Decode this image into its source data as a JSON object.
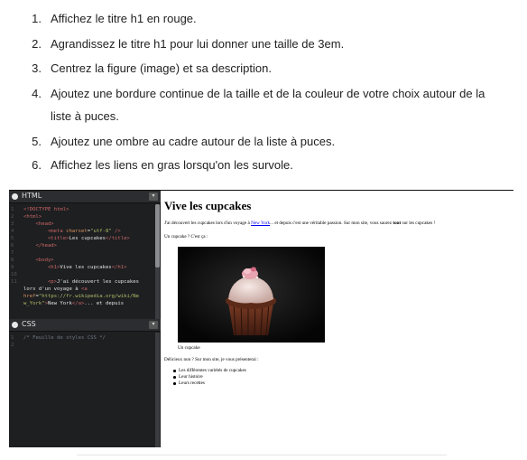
{
  "instructions": [
    {
      "num": "1.",
      "text": "Affichez le titre h1 en rouge."
    },
    {
      "num": "2.",
      "text": "Agrandissez le titre h1 pour lui donner une taille de 3em."
    },
    {
      "num": "3.",
      "text": "Centrez la figure (image) et sa description."
    },
    {
      "num": "4.",
      "text": "Ajoutez une bordure continue de la taille et de la couleur de votre choix autour de la",
      "cont": "liste à puces."
    },
    {
      "num": "5.",
      "text": "Ajoutez une ombre au cadre autour de la liste à puces."
    },
    {
      "num": "6.",
      "text": "Affichez les liens en gras lorsqu'on les survole."
    }
  ],
  "editor": {
    "html_pane_title": "HTML",
    "css_pane_title": "CSS",
    "html_lines": [
      {
        "ln": "1",
        "segs": [
          {
            "c": "tag",
            "t": "<!DOCTYPE html>"
          }
        ]
      },
      {
        "ln": "2",
        "segs": [
          {
            "c": "tag",
            "t": "<html>"
          }
        ]
      },
      {
        "ln": "3",
        "segs": [
          {
            "c": "tag",
            "t": "    <head>"
          }
        ]
      },
      {
        "ln": "4",
        "segs": [
          {
            "c": "tag",
            "t": "        <meta "
          },
          {
            "c": "attr",
            "t": "charset"
          },
          {
            "c": "txt",
            "t": "="
          },
          {
            "c": "str",
            "t": "\"utf-8\""
          },
          {
            "c": "tag",
            "t": " />"
          }
        ]
      },
      {
        "ln": "5",
        "segs": [
          {
            "c": "tag",
            "t": "        <title>"
          },
          {
            "c": "txt",
            "t": "Les cupcakes"
          },
          {
            "c": "tag",
            "t": "</title>"
          }
        ]
      },
      {
        "ln": "6",
        "segs": [
          {
            "c": "tag",
            "t": "    </head>"
          }
        ]
      },
      {
        "ln": "7",
        "segs": []
      },
      {
        "ln": "8",
        "segs": [
          {
            "c": "tag",
            "t": "    <body>"
          }
        ]
      },
      {
        "ln": "9",
        "segs": [
          {
            "c": "tag",
            "t": "        <h1>"
          },
          {
            "c": "txt",
            "t": "Vive les cupcakes"
          },
          {
            "c": "tag",
            "t": "</h1>"
          }
        ]
      },
      {
        "ln": "10",
        "segs": []
      },
      {
        "ln": "11",
        "segs": [
          {
            "c": "tag",
            "t": "        <p>"
          },
          {
            "c": "txt",
            "t": "J'ai découvert les cupcakes"
          }
        ]
      },
      {
        "ln": "",
        "segs": [
          {
            "c": "txt",
            "t": "lors d'un voyage à "
          },
          {
            "c": "tag",
            "t": "<a"
          }
        ]
      },
      {
        "ln": "",
        "segs": [
          {
            "c": "attr",
            "t": "href"
          },
          {
            "c": "txt",
            "t": "="
          },
          {
            "c": "str",
            "t": "\"https://fr.wikipedia.org/wiki/Ne"
          }
        ]
      },
      {
        "ln": "",
        "segs": [
          {
            "c": "str",
            "t": "w_York\""
          },
          {
            "c": "tag",
            "t": ">"
          },
          {
            "c": "txt",
            "t": "New York"
          },
          {
            "c": "tag",
            "t": "</a>"
          },
          {
            "c": "txt",
            "t": "... et depuis"
          }
        ]
      }
    ],
    "css_lines": [
      {
        "ln": "1",
        "segs": [
          {
            "c": "cmt",
            "t": "/* Feuille de styles CSS */"
          }
        ]
      },
      {
        "ln": "2",
        "segs": []
      }
    ]
  },
  "preview": {
    "h1": "Vive les cupcakes",
    "p1_before": "J'ai découvert les cupcakes lors d'un voyage à ",
    "p1_link": "New York",
    "p1_middle": "... et depuis c'est une véritable passion. Sur mon site, vous saurez ",
    "p1_bold": "tout",
    "p1_after": " sur les cupcakes !",
    "p2": "Un cupcake ? C'est ça :",
    "caption": "Un cupcake",
    "p3": "Délicieux non ? Sur mon site, je vous présenterai :",
    "list": [
      "Les différentes variétés de cupcakes",
      "Leur histoire",
      "Leurs recettes"
    ]
  }
}
